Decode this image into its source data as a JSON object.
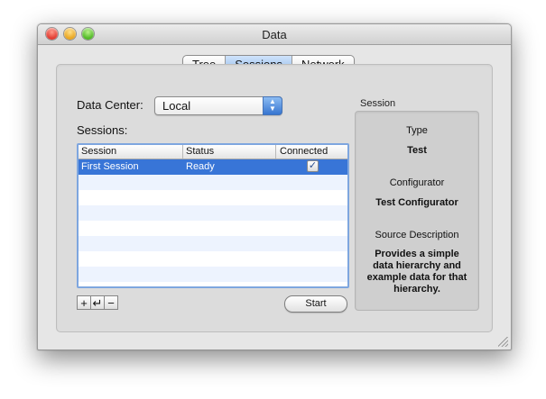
{
  "window": {
    "title": "Data"
  },
  "tabs": [
    {
      "label": "Tree"
    },
    {
      "label": "Sessions",
      "selected": true
    },
    {
      "label": "Network"
    }
  ],
  "data_center": {
    "label": "Data Center:",
    "selected_value": "Local"
  },
  "sessions": {
    "label": "Sessions:",
    "columns": [
      "Session",
      "Status",
      "Connected"
    ],
    "rows": [
      {
        "session": "First Session",
        "status": "Ready",
        "connected": true,
        "selected": true
      }
    ],
    "add_label": "+",
    "edit_label": "↵",
    "remove_label": "−",
    "start_label": "Start"
  },
  "session_panel": {
    "title": "Session",
    "type_label": "Type",
    "type_value": "Test",
    "configurator_label": "Configurator",
    "configurator_value": "Test Configurator",
    "source_label": "Source Description",
    "source_value": "Provides a simple data hierarchy and example data for that hierarchy."
  },
  "colors": {
    "selection": "#3875d7",
    "accent": "#8fb8ea"
  }
}
